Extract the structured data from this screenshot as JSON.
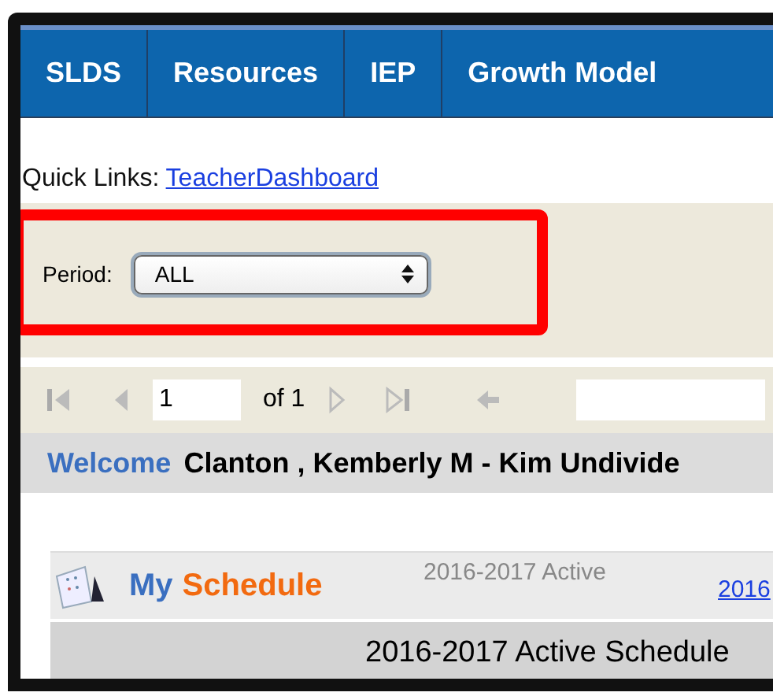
{
  "nav_tabs": [
    {
      "label": "SLDS"
    },
    {
      "label": "Resources"
    },
    {
      "label": "IEP"
    },
    {
      "label": "Growth Model"
    }
  ],
  "quick_links": {
    "label": "Quick Links:",
    "link": "TeacherDashboard"
  },
  "period_filter": {
    "label": "Period:",
    "value": "ALL"
  },
  "pager": {
    "page": "1",
    "of_label": "of 1"
  },
  "welcome": {
    "greeting": "Welcome",
    "name": "Clanton , Kemberly M - Kim Undivide"
  },
  "schedule": {
    "title_first": "My",
    "title_second": "Schedule",
    "subtitle": "2016-2017 Active",
    "link": "2016",
    "row": "2016-2017 Active Schedule"
  }
}
